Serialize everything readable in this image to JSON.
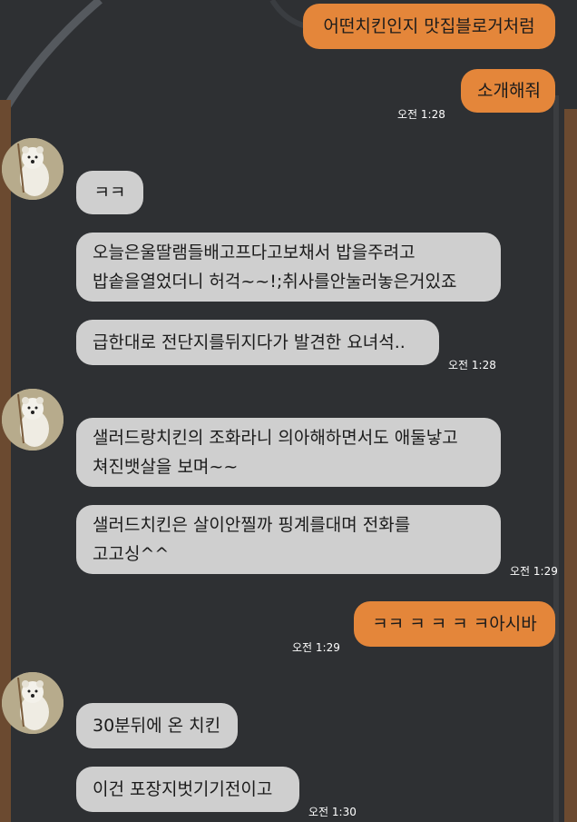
{
  "messages": [
    {
      "side": "me",
      "text": "어떤치킨인지 맛집블로거처럼"
    },
    {
      "side": "me",
      "text": "소개해줘",
      "time": "오전 1:28"
    },
    {
      "side": "them",
      "text": "ㅋㅋ"
    },
    {
      "side": "them",
      "lines": [
        "오늘은울딸램들배고프다고보채서 밥을주려고",
        "밥솥을열었더니 허걱~~!;취사를안눌러놓은거있죠"
      ]
    },
    {
      "side": "them",
      "text": "급한대로 전단지를뒤지다가 발견한 요녀석..",
      "time": "오전 1:28"
    },
    {
      "side": "them",
      "lines": [
        "샐러드랑치킨의 조화라니 의아해하면서도 애둘낳고",
        "쳐진뱃살을 보며~~"
      ]
    },
    {
      "side": "them",
      "lines": [
        "샐러드치킨은 살이안찔까 핑계를대며 전화를",
        "고고싱^^"
      ],
      "time": "오전 1:29"
    },
    {
      "side": "me",
      "text": "ㅋㅋ ㅋ ㅋ ㅋ ㅋ아시바",
      "time": "오전 1:29"
    },
    {
      "side": "them",
      "text": "30분뒤에 온 치킨"
    },
    {
      "side": "them",
      "text": "이건 포장지벗기기전이고",
      "time": "오전 1:30"
    }
  ],
  "colors": {
    "background": "#2e3033",
    "my_bubble": "#e4863a",
    "their_bubble": "#cfcfcf"
  },
  "icons": {
    "avatar": "polar-bear-avatar-icon"
  }
}
